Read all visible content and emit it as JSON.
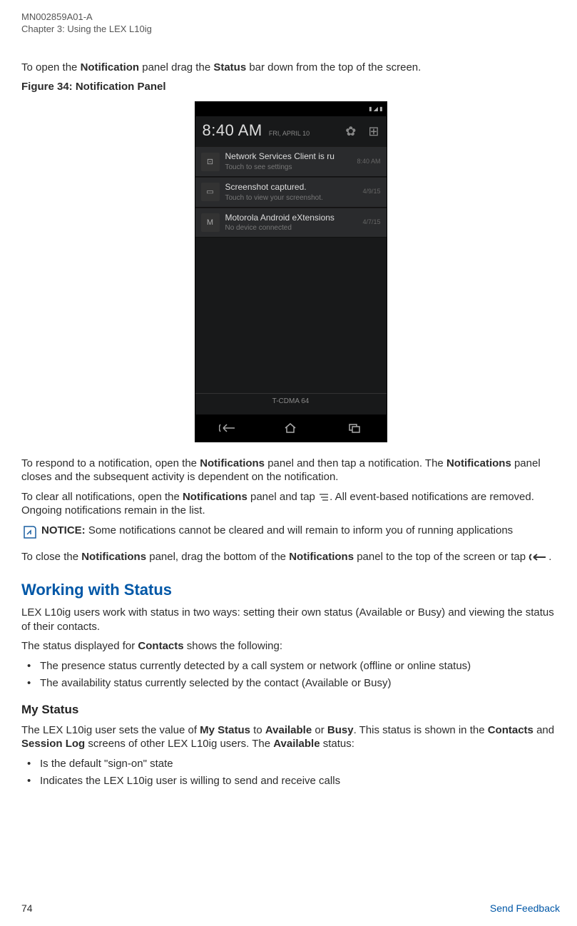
{
  "header": {
    "doc_id": "MN002859A01-A",
    "chapter": "Chapter 3:  Using the LEX L10ig"
  },
  "intro": {
    "p1_a": "To open the ",
    "p1_b": "Notification",
    "p1_c": " panel drag the ",
    "p1_d": "Status",
    "p1_e": " bar down from the top of the screen."
  },
  "figure_caption": "Figure 34: Notification Panel",
  "screenshot": {
    "time": "8:40 AM",
    "date": "FRI, APRIL 10",
    "grid_icon": "⊞",
    "notifs": [
      {
        "icon": "⊡",
        "title": "Network Services Client is ru",
        "sub": "Touch to see settings",
        "date": "8:40 AM"
      },
      {
        "icon": "▭",
        "title": "Screenshot captured.",
        "sub": "Touch to view your screenshot.",
        "date": "4/9/15"
      },
      {
        "icon": "M",
        "title": "Motorola Android eXtensions",
        "sub": "No device connected",
        "date": "4/7/15"
      }
    ],
    "carrier": "T-CDMA 64"
  },
  "respond": {
    "a": "To respond to a notification, open the ",
    "b": "Notifications",
    "c": " panel and then tap a notification. The ",
    "d": "Notifications",
    "e": " panel closes and the subsequent activity is dependent on the notification."
  },
  "clear": {
    "a": "To clear all notifications, open the ",
    "b": "Notifications",
    "c": " panel and tap ",
    "d": ". All event-based notifications are removed. Ongoing notifications remain in the list."
  },
  "notice": {
    "label": "NOTICE:",
    "text": " Some notifications cannot be cleared and will remain to inform you of running applications"
  },
  "close": {
    "a": "To close the ",
    "b": "Notifications",
    "c": " panel, drag the bottom of the ",
    "d": "Notifications",
    "e": " panel to the top of the screen or tap ",
    "f": "."
  },
  "status_section": {
    "title": "Working with Status",
    "p1": "LEX L10ig users work with status in two ways: setting their own status (Available or Busy) and viewing the status of their contacts.",
    "p2_a": "The status displayed for ",
    "p2_b": "Contacts",
    "p2_c": " shows the following:",
    "bullets": [
      "The presence status currently detected by a call system or network (offline or online status)",
      "The availability status currently selected by the contact (Available or Busy)"
    ]
  },
  "mystatus": {
    "title": "My Status",
    "p1_a": "The LEX L10ig user sets the value of ",
    "p1_b": "My Status",
    "p1_c": " to ",
    "p1_d": "Available",
    "p1_e": " or ",
    "p1_f": "Busy",
    "p1_g": ". This status is shown in the ",
    "p1_h": "Contacts",
    "p1_i": " and ",
    "p1_j": "Session Log",
    "p1_k": " screens of other LEX L10ig users. The ",
    "p1_l": "Available",
    "p1_m": " status:",
    "bullets": [
      "Is the default \"sign-on\" state",
      "Indicates the LEX L10ig user is willing to send and receive calls"
    ]
  },
  "footer": {
    "page": "74",
    "feedback": "Send Feedback"
  }
}
